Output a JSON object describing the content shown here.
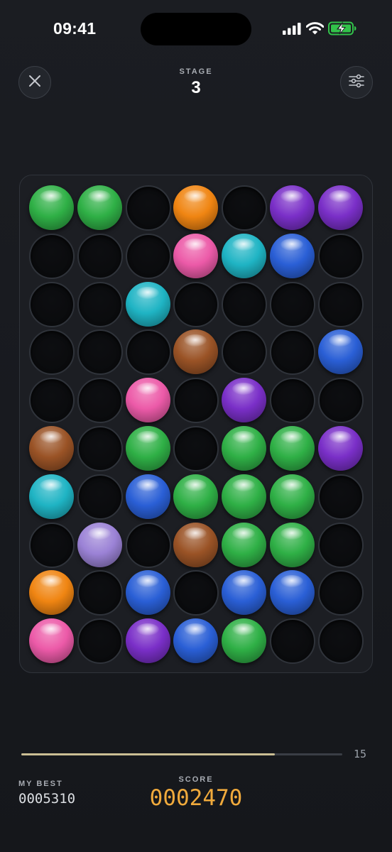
{
  "status_bar": {
    "time": "09:41"
  },
  "header": {
    "stage_label": "STAGE",
    "stage_value": "3"
  },
  "palette": {
    "green": "#2fb046",
    "orange": "#f08512",
    "purple": "#7a2fc8",
    "pink": "#ec5aa8",
    "cyan": "#1fb4c4",
    "blue": "#2a5fd6",
    "brown": "#9a5326",
    "lavender": "#9b82d6"
  },
  "board": {
    "rows": 10,
    "cols": 7,
    "cells": [
      [
        "green",
        "green",
        null,
        "orange",
        null,
        "purple",
        "purple"
      ],
      [
        null,
        null,
        null,
        "pink",
        "cyan",
        "blue",
        null
      ],
      [
        null,
        null,
        "cyan",
        null,
        null,
        null,
        null
      ],
      [
        null,
        null,
        null,
        "brown",
        null,
        null,
        "blue"
      ],
      [
        null,
        null,
        "pink",
        null,
        "purple",
        null,
        null
      ],
      [
        "brown",
        null,
        "green",
        null,
        "green",
        "green",
        "purple"
      ],
      [
        "cyan",
        null,
        "blue",
        "green",
        "green",
        "green",
        null
      ],
      [
        null,
        "lavender",
        null,
        "brown",
        "green",
        "green",
        null
      ],
      [
        "orange",
        null,
        "blue",
        null,
        "blue",
        "blue",
        null
      ],
      [
        "pink",
        null,
        "purple",
        "blue",
        "green",
        null,
        null
      ]
    ]
  },
  "progress": {
    "fraction": 0.79,
    "moves_left": "15"
  },
  "footer": {
    "best_label": "MY BEST",
    "best_value": "0005310",
    "score_label": "SCORE",
    "score_value": "0002470"
  }
}
